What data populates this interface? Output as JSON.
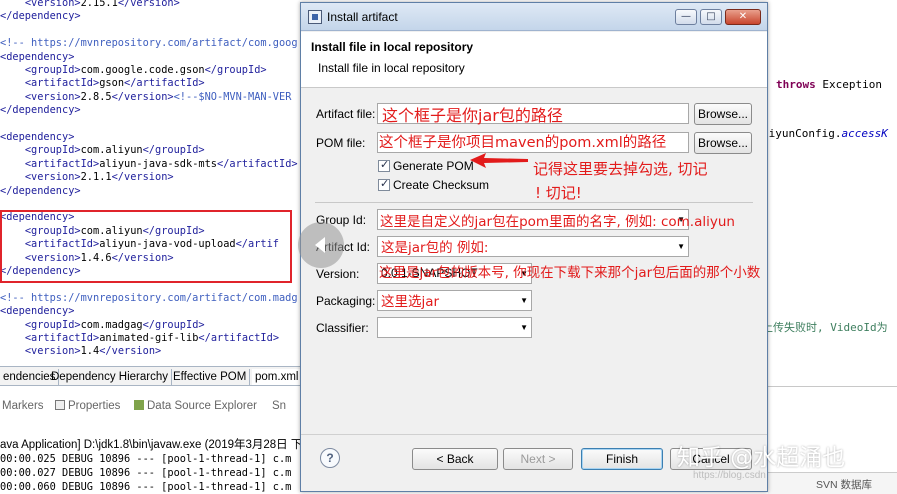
{
  "xml_editor": {
    "lines": [
      {
        "parts": [
          {
            "t": "    ",
            "c": "txt"
          },
          {
            "t": "<version>",
            "c": "tag"
          },
          {
            "t": "2.15.1",
            "c": "txt"
          },
          {
            "t": "</version>",
            "c": "tag"
          }
        ]
      },
      {
        "parts": [
          {
            "t": "</dependency>",
            "c": "tag"
          }
        ]
      },
      {
        "parts": []
      },
      {
        "parts": [
          {
            "t": "<!-- https://mvnrepository.com/artifact/com.goog",
            "c": "cmt"
          }
        ]
      },
      {
        "parts": [
          {
            "t": "<dependency>",
            "c": "tag"
          }
        ]
      },
      {
        "parts": [
          {
            "t": "    ",
            "c": "txt"
          },
          {
            "t": "<groupId>",
            "c": "tag"
          },
          {
            "t": "com.google.code.gson",
            "c": "txt"
          },
          {
            "t": "</groupId>",
            "c": "tag"
          }
        ]
      },
      {
        "parts": [
          {
            "t": "    ",
            "c": "txt"
          },
          {
            "t": "<artifactId>",
            "c": "tag"
          },
          {
            "t": "gson",
            "c": "txt"
          },
          {
            "t": "</artifactId>",
            "c": "tag"
          }
        ]
      },
      {
        "parts": [
          {
            "t": "    ",
            "c": "txt"
          },
          {
            "t": "<version>",
            "c": "tag"
          },
          {
            "t": "2.8.5",
            "c": "txt"
          },
          {
            "t": "</version>",
            "c": "tag"
          },
          {
            "t": "<!--$NO-MVN-MAN-VER",
            "c": "cmt"
          }
        ]
      },
      {
        "parts": [
          {
            "t": "</dependency>",
            "c": "tag"
          }
        ]
      },
      {
        "parts": []
      },
      {
        "parts": [
          {
            "t": "<dependency>",
            "c": "tag"
          }
        ]
      },
      {
        "parts": [
          {
            "t": "    ",
            "c": "txt"
          },
          {
            "t": "<groupId>",
            "c": "tag"
          },
          {
            "t": "com.aliyun",
            "c": "txt"
          },
          {
            "t": "</groupId>",
            "c": "tag"
          }
        ]
      },
      {
        "parts": [
          {
            "t": "    ",
            "c": "txt"
          },
          {
            "t": "<artifactId>",
            "c": "tag"
          },
          {
            "t": "aliyun-java-sdk-mts",
            "c": "txt"
          },
          {
            "t": "</artifactId>",
            "c": "tag"
          }
        ]
      },
      {
        "parts": [
          {
            "t": "    ",
            "c": "txt"
          },
          {
            "t": "<version>",
            "c": "tag"
          },
          {
            "t": "2.1.1",
            "c": "txt"
          },
          {
            "t": "</version>",
            "c": "tag"
          }
        ]
      },
      {
        "parts": [
          {
            "t": "</dependency>",
            "c": "tag"
          }
        ]
      },
      {
        "parts": []
      },
      {
        "parts": [
          {
            "t": "<dependency>",
            "c": "tag"
          }
        ]
      },
      {
        "parts": [
          {
            "t": "    ",
            "c": "txt"
          },
          {
            "t": "<groupId>",
            "c": "tag"
          },
          {
            "t": "com.aliyun",
            "c": "txt"
          },
          {
            "t": "</groupId>",
            "c": "tag"
          }
        ]
      },
      {
        "parts": [
          {
            "t": "    ",
            "c": "txt"
          },
          {
            "t": "<artifactId>",
            "c": "tag"
          },
          {
            "t": "aliyun-java-vod-upload",
            "c": "txt"
          },
          {
            "t": "</artif",
            "c": "tag"
          }
        ]
      },
      {
        "parts": [
          {
            "t": "    ",
            "c": "txt"
          },
          {
            "t": "<version>",
            "c": "tag"
          },
          {
            "t": "1.4.6",
            "c": "txt"
          },
          {
            "t": "</version>",
            "c": "tag"
          }
        ]
      },
      {
        "parts": [
          {
            "t": "</dependency>",
            "c": "tag"
          }
        ]
      },
      {
        "parts": []
      },
      {
        "parts": [
          {
            "t": "<!-- https://mvnrepository.com/artifact/com.madg",
            "c": "cmt"
          }
        ]
      },
      {
        "parts": [
          {
            "t": "<dependency>",
            "c": "tag"
          }
        ]
      },
      {
        "parts": [
          {
            "t": "    ",
            "c": "txt"
          },
          {
            "t": "<groupId>",
            "c": "tag"
          },
          {
            "t": "com.madgag",
            "c": "txt"
          },
          {
            "t": "</groupId>",
            "c": "tag"
          }
        ]
      },
      {
        "parts": [
          {
            "t": "    ",
            "c": "txt"
          },
          {
            "t": "<artifactId>",
            "c": "tag"
          },
          {
            "t": "animated-gif-lib",
            "c": "txt"
          },
          {
            "t": "</artifactId>",
            "c": "tag"
          }
        ]
      },
      {
        "parts": [
          {
            "t": "    ",
            "c": "txt"
          },
          {
            "t": "<version>",
            "c": "tag"
          },
          {
            "t": "1.4",
            "c": "txt"
          },
          {
            "t": "</version>",
            "c": "tag"
          }
        ]
      }
    ]
  },
  "pom_tabs": [
    "endencies",
    "Dependency Hierarchy",
    "Effective POM",
    "pom.xml"
  ],
  "views": {
    "markers": "Markers",
    "properties": "Properties",
    "data_source_explorer": "Data Source Explorer",
    "snippets": "Sn"
  },
  "console": {
    "title": "ava Application] D:\\jdk1.8\\bin\\javaw.exe (2019年3月28日 下",
    "lines": [
      "00:00.025 DEBUG 10896 --- [pool-1-thread-1] c.m",
      "00:00.027 DEBUG 10896 --- [pool-1-thread-1] c.m",
      "00:00.060 DEBUG 10896 --- [pool-1-thread-1] c.m"
    ]
  },
  "java_editor": {
    "line1_kw": "throws",
    "line1_txt": " Exception",
    "line2_txt": "liyunConfig.",
    "line2_fld": "accessK",
    "line3_cmt": "上传失败时, VideoId为",
    "svn_label": "SVN 数据库"
  },
  "dialog": {
    "title": "Install artifact",
    "window_buttons": {
      "minimize": "—",
      "maximize": "□",
      "close": "✕"
    },
    "header_title": "Install file in local repository",
    "header_desc": "Install file in local repository",
    "labels": {
      "artifact_file": "Artifact file:",
      "pom_file": "POM file:",
      "group_id": "Group Id:",
      "artifact_id": "Artifact Id:",
      "version": "Version:",
      "packaging": "Packaging:",
      "classifier": "Classifier:"
    },
    "values": {
      "artifact_file": "",
      "pom_file": "",
      "group_id": "",
      "artifact_id": "",
      "version": "0.0.1-SNAPSHOT",
      "packaging": "",
      "classifier": ""
    },
    "browse_label": "Browse...",
    "checkboxes": {
      "generate_pom": {
        "label": "Generate POM",
        "checked": true
      },
      "create_checksum": {
        "label": "Create Checksum",
        "checked": true
      }
    },
    "buttons": {
      "help": "?",
      "back": "< Back",
      "next": "Next >",
      "finish": "Finish",
      "cancel": "Cancel"
    }
  },
  "annotations": {
    "artifact_file": "这个框子是你jar包的路径",
    "pom_file": "这个框子是你项目maven的pom.xml的路径",
    "generate_pom_1": "记得这里要去掉勾选, 切记",
    "generate_pom_2": "! 切记!",
    "group_id": "这里是自定义的jar包在pom里面的名字, 例如: com.aliyun",
    "artifact_id": "这是jar包的  例如:",
    "version": "这里是jar包的版本号, 你现在下载下来那个jar包后面的那个小数",
    "packaging": "这里选jar"
  },
  "watermark": {
    "text": "知乎 @水超涌也",
    "url": "https://blog.csdn"
  },
  "colors": {
    "annotation_red": "#e21b1b",
    "xml_tag": "#1f1f9c",
    "xml_comment": "#3f5fbf",
    "java_keyword": "#7f0055"
  }
}
